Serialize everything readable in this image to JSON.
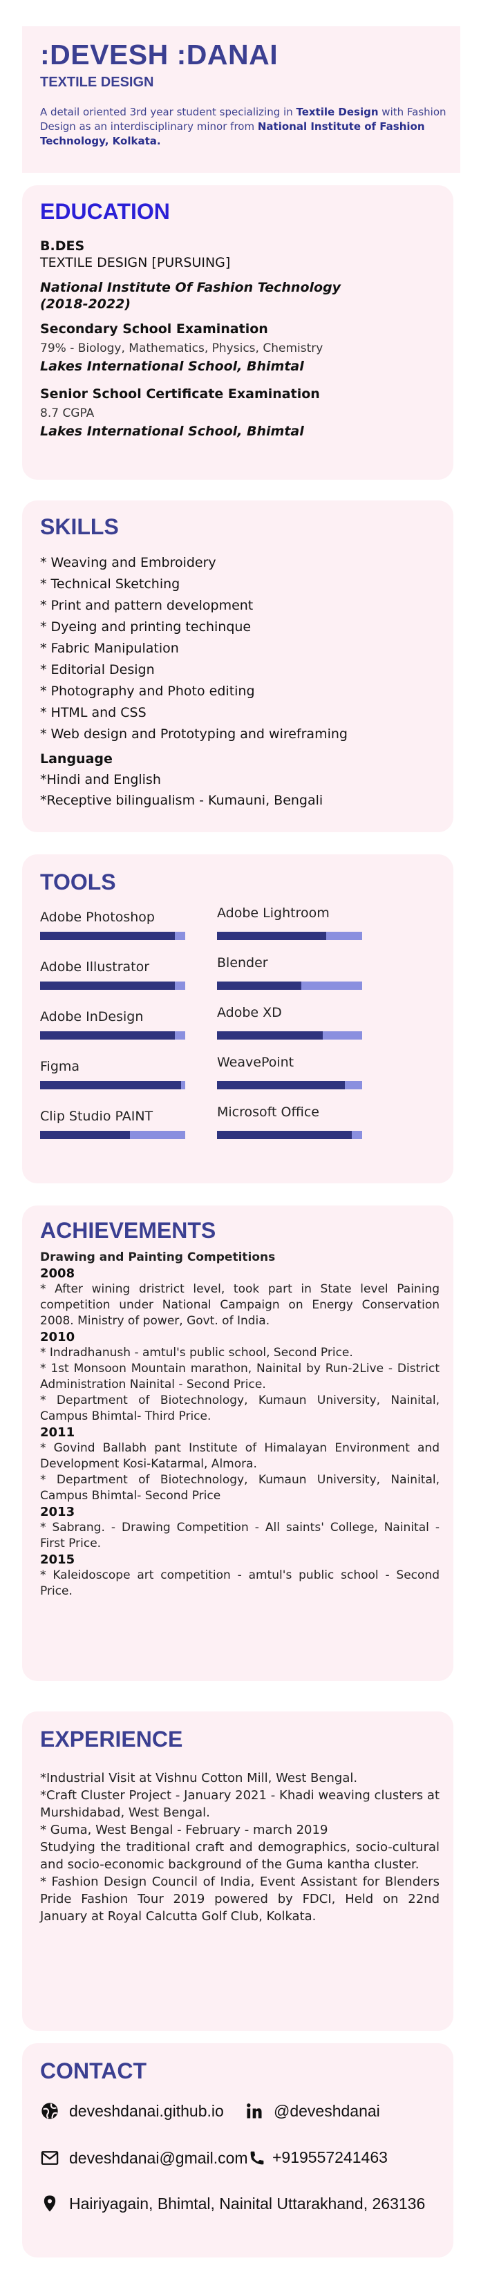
{
  "header": {
    "name": ":DEVESH :DANAI",
    "subtitle": "TEXTILE DESIGN",
    "intro_parts": [
      "A detail oriented 3rd year student specializing in ",
      "Textile Design",
      " with Fashion Design as an interdisciplinary minor from ",
      "National Institute of Fashion Technology, Kolkata."
    ]
  },
  "education": {
    "title": "EDUCATION",
    "degree": "B.DES",
    "program": "TEXTILE DESIGN [PURSUING]",
    "institute": "National Institute Of Fashion Technology",
    "years": "(2018-2022)",
    "sec_exam": "Secondary School Examination",
    "sec_detail": "79% - Biology, Mathematics, Physics, Chemistry",
    "sec_school": "Lakes International School, Bhimtal",
    "sen_exam": "Senior School Certificate Examination",
    "sen_detail": "8.7 CGPA",
    "sen_school": "Lakes International School, Bhimtal"
  },
  "skills": {
    "title": "SKILLS",
    "items": [
      "* Weaving and Embroidery",
      "* Technical Sketching",
      "* Print and pattern development",
      "* Dyeing and printing techinque",
      "* Fabric Manipulation",
      "* Editorial Design",
      "* Photography and Photo editing",
      "* HTML and CSS",
      "* Web design and Prototyping and wireframing"
    ],
    "language_title": "Language",
    "languages": [
      "*Hindi and English",
      "*Receptive bilingualism - Kumauni, Bengali"
    ]
  },
  "tools": {
    "title": "TOOLS",
    "items": [
      {
        "name": "Adobe Photoshop",
        "level": 0.93
      },
      {
        "name": "Adobe Lightroom",
        "level": 0.75
      },
      {
        "name": "Adobe Illustrator",
        "level": 0.93
      },
      {
        "name": "Blender",
        "level": 0.58
      },
      {
        "name": "Adobe InDesign",
        "level": 0.93
      },
      {
        "name": "Adobe XD",
        "level": 0.73
      },
      {
        "name": "Figma",
        "level": 0.97
      },
      {
        "name": "WeavePoint",
        "level": 0.88
      },
      {
        "name": "Clip Studio PAINT",
        "level": 0.62
      },
      {
        "name": "Microsoft Office",
        "level": 0.93
      }
    ]
  },
  "achievements": {
    "title": "ACHIEVEMENTS",
    "lines": [
      {
        "type": "head",
        "text": "Drawing and Painting Competitions"
      },
      {
        "type": "year",
        "text": "2008"
      },
      {
        "type": "item",
        "text": "* After wining dristrict level, took part in State level Paining competition under National Campaign on Energy Conservation 2008. Ministry of power, Govt. of India."
      },
      {
        "type": "year",
        "text": "2010"
      },
      {
        "type": "item",
        "text": "* Indradhanush - amtul's public school, Second Price."
      },
      {
        "type": "item",
        "text": "* 1st Monsoon Mountain marathon, Nainital by Run-2Live - District Administration Nainital - Second Price."
      },
      {
        "type": "item",
        "text": "* Department of Biotechnology, Kumaun University, Nainital, Campus Bhimtal- Third Price."
      },
      {
        "type": "year",
        "text": "2011"
      },
      {
        "type": "item",
        "text": "* Govind Ballabh pant Institute of Himalayan Environment and Development Kosi-Katarmal, Almora."
      },
      {
        "type": "item",
        "text": "* Department of Biotechnology, Kumaun University, Nainital, Campus Bhimtal- Second Price"
      },
      {
        "type": "year",
        "text": "2013"
      },
      {
        "type": "item",
        "text": "* Sabrang. - Drawing Competition - All saints' College, Nainital - First Price."
      },
      {
        "type": "year",
        "text": "2015"
      },
      {
        "type": "item",
        "text": "* Kaleidoscope art competition - amtul's public school - Second Price."
      }
    ]
  },
  "experience": {
    "title": "EXPERIENCE",
    "lines": [
      "*Industrial Visit at Vishnu Cotton Mill, West Bengal.",
      "*Craft Cluster Project - January 2021 - Khadi weaving clusters at Murshidabad, West Bengal.",
      "* Guma, West Bengal - February - march 2019",
      "Studying the traditional craft and demographics, socio-cultural and socio-economic background of the Guma kantha cluster.",
      "* Fashion Design Council of India, Event Assistant for Blenders Pride Fashion Tour 2019 powered by FDCI, Held on 22nd January at Royal Calcutta Golf Club, Kolkata."
    ]
  },
  "contact": {
    "title": "CONTACT",
    "website": "deveshdanai.github.io",
    "linkedin": "@deveshdanai",
    "email": "deveshdanai@gmail.com",
    "phone": "+919557241463",
    "address": "Hairiyagain, Bhimtal, Nainital Uttarakhand, 263136"
  },
  "colors": {
    "accent": "#3b3f91",
    "education_title": "#2b1fd6",
    "card_bg": "#fdf0f4",
    "bar_dark": "#2f347e",
    "bar_light": "#8a8fdf"
  }
}
